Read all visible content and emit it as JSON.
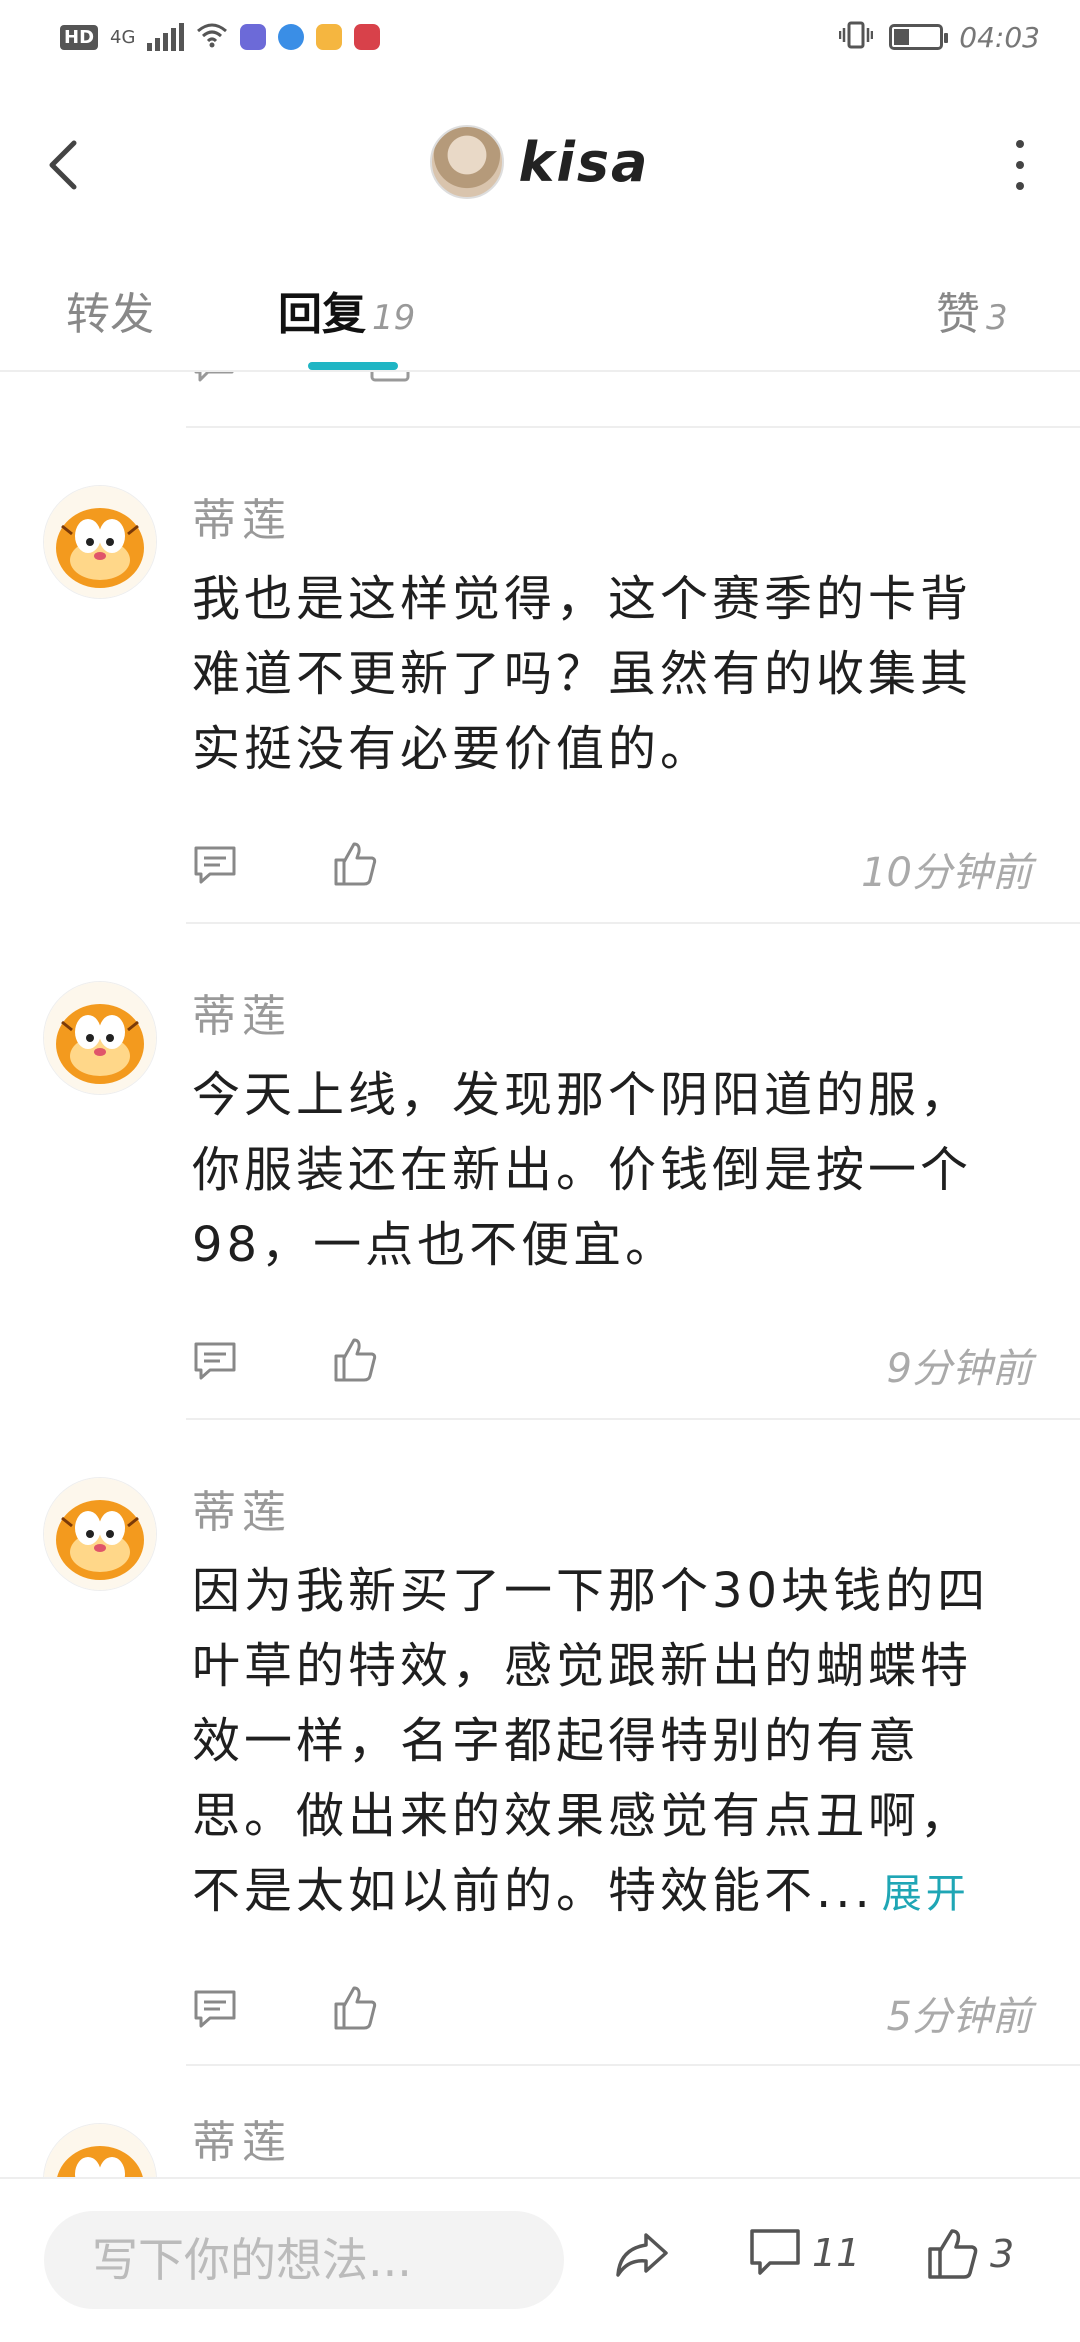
{
  "status_bar": {
    "hd": "HD",
    "network": "4G",
    "time": "04:03",
    "battery_level": 0.3
  },
  "header": {
    "title": "kisa",
    "back_icon": "chevron-left-icon",
    "more_icon": "more-vertical-icon"
  },
  "tabs": [
    {
      "label": "转发",
      "count": ""
    },
    {
      "label": "回复",
      "count": "19"
    },
    {
      "label": "赞",
      "count": "3"
    }
  ],
  "active_tab": 1,
  "comments": [
    {
      "name": "蒂莲",
      "text": "我也是这样觉得，这个赛季的卡背难道不更新了吗？虽然有的收集其实挺没有必要价值的。",
      "time": "10分钟前",
      "expand": ""
    },
    {
      "name": "蒂莲",
      "text": "今天上线，发现那个阴阳道的服，你服装还在新出。价钱倒是按一个98，一点也不便宜。",
      "time": "9分钟前",
      "expand": ""
    },
    {
      "name": "蒂莲",
      "text": "因为我新买了一下那个30块钱的四叶草的特效，感觉跟新出的蝴蝶特效一样，名字都起得特别的有意思。做出来的效果感觉有点丑啊，不是太如以前的。特效能不...",
      "time": "5分钟前",
      "expand": "展开"
    },
    {
      "name": "蒂莲",
      "text": "",
      "time": "",
      "expand": ""
    }
  ],
  "bottom_bar": {
    "input_placeholder": "写下你的想法...",
    "comment_count": "11",
    "like_count": "3"
  }
}
